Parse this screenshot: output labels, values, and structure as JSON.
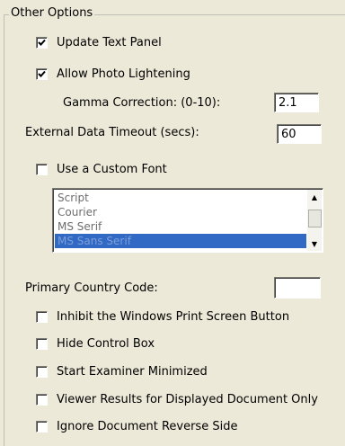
{
  "group": {
    "title": "Other Options"
  },
  "options": {
    "update_text_panel": {
      "label": "Update Text Panel",
      "checked": true
    },
    "allow_photo_lightening": {
      "label": "Allow Photo Lightening",
      "checked": true
    },
    "use_custom_font": {
      "label": "Use a Custom Font",
      "checked": false
    },
    "inhibit_print_screen": {
      "label": "Inhibit the Windows Print Screen Button",
      "checked": false
    },
    "hide_control_box": {
      "label": "Hide Control Box",
      "checked": false
    },
    "start_minimized": {
      "label": "Start Examiner Minimized",
      "checked": false
    },
    "viewer_results_only": {
      "label": "Viewer Results for Displayed Document Only",
      "checked": false
    },
    "ignore_reverse_side": {
      "label": "Ignore Document Reverse Side",
      "checked": false
    }
  },
  "fields": {
    "gamma": {
      "label": "Gamma Correction: (0-10):",
      "value": "2.1"
    },
    "timeout": {
      "label": "External Data Timeout (secs):",
      "value": "60"
    },
    "country_code": {
      "label": "Primary Country Code:",
      "value": ""
    }
  },
  "font_list": {
    "items": [
      "Script",
      "Courier",
      "MS Serif",
      "MS Sans Serif"
    ],
    "selected": "MS Sans Serif"
  },
  "colors": {
    "selection": "#316ac5",
    "panel_bg": "#ece9d8"
  }
}
